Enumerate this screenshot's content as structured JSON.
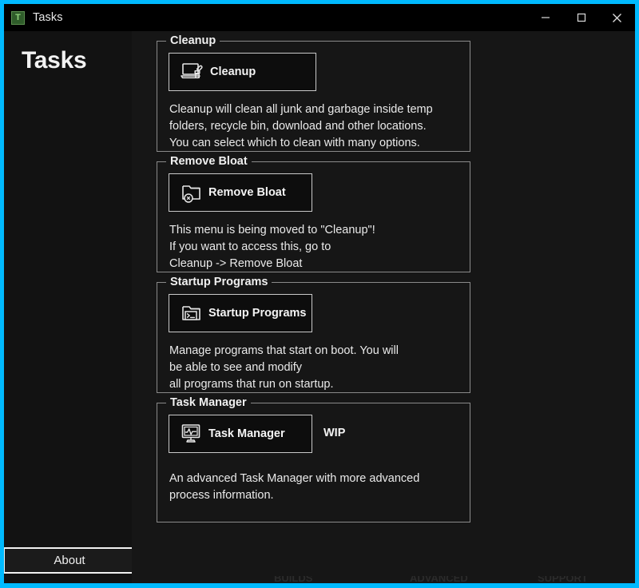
{
  "window": {
    "title": "Tasks",
    "app_icon": "T",
    "accent_color": "#00baff",
    "background_color": "#161616",
    "titlebar_color": "#000000",
    "controls": [
      {
        "name": "minimize",
        "icon": "minimize-icon"
      },
      {
        "name": "maximize",
        "icon": "maximize-icon"
      },
      {
        "name": "close",
        "icon": "close-icon"
      }
    ]
  },
  "sidebar": {
    "heading": "Tasks",
    "about_label": "About"
  },
  "groups": [
    {
      "title": "Cleanup",
      "button_label": "Cleanup",
      "icon": "laptop-brush-icon",
      "description": "Cleanup will clean all junk and garbage inside temp\nfolders, recycle bin, download and other locations.\nYou can select which to clean with many options."
    },
    {
      "title": "Remove Bloat",
      "button_label": "Remove Bloat",
      "icon": "folder-remove-icon",
      "description": "This menu is being moved to \"Cleanup\"!\nIf you want to access this, go to\nCleanup -> Remove Bloat"
    },
    {
      "title": "Startup Programs",
      "button_label": "Startup Programs",
      "icon": "folder-terminal-icon",
      "description": "Manage programs that start on boot. You will\nbe able to see and modify\nall programs that run on startup."
    },
    {
      "title": "Task Manager",
      "button_label": "Task Manager",
      "icon": "monitor-graph-icon",
      "badge": "WIP",
      "description": "An advanced Task Manager with more advanced\n process information."
    }
  ],
  "clipped_bottom_text": {
    "a": "BUILDS",
    "b": "ADVANCED",
    "c": "SUPPORT"
  }
}
